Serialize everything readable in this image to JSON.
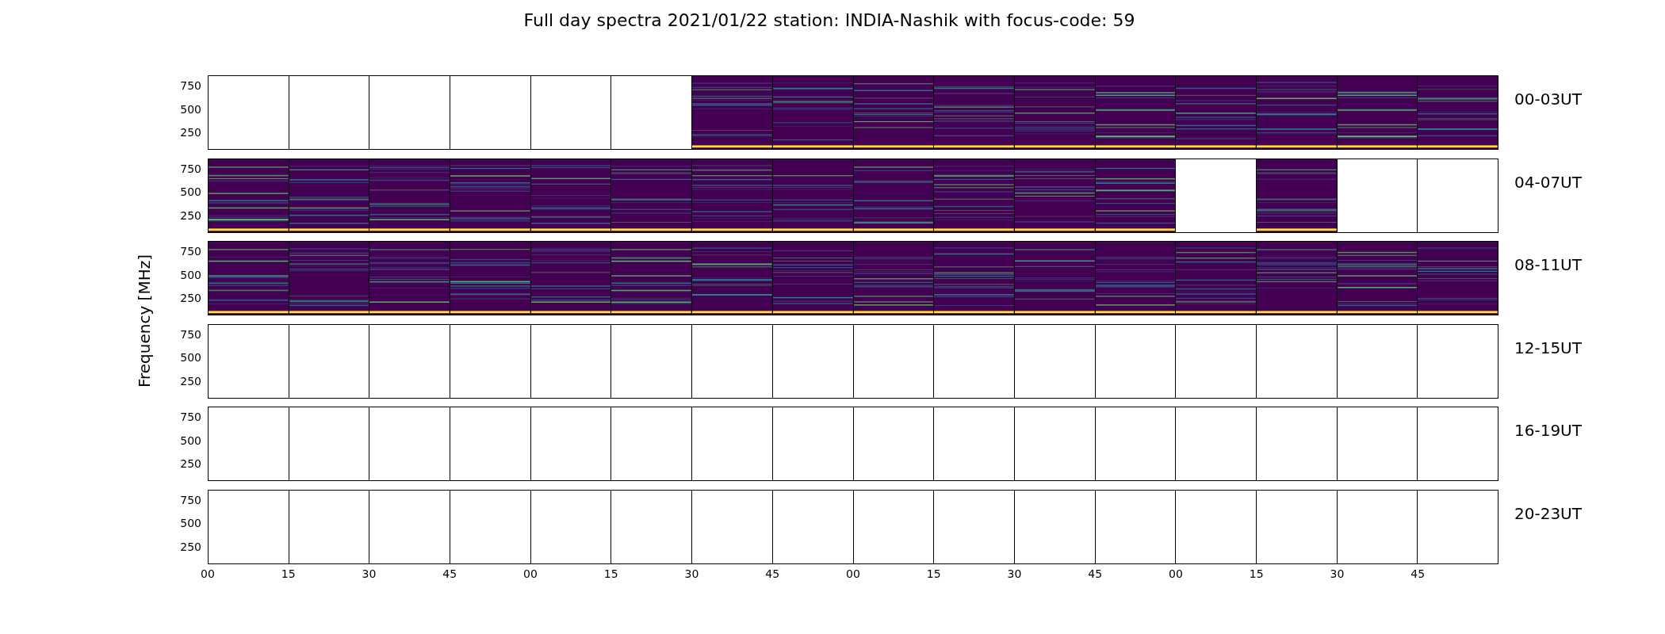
{
  "title": "Full day spectra 2021/01/22 station: INDIA-Nashik with focus-code: 59",
  "ylabel": "Frequency [MHz]",
  "rows": [
    {
      "label": "00-03UT",
      "yticks": [
        "750",
        "500",
        "250"
      ],
      "panels": [
        false,
        false,
        false,
        false,
        false,
        false,
        true,
        true,
        true,
        true,
        true,
        true,
        true,
        true,
        true,
        true
      ]
    },
    {
      "label": "04-07UT",
      "yticks": [
        "750",
        "500",
        "250"
      ],
      "panels": [
        true,
        true,
        true,
        true,
        true,
        true,
        true,
        true,
        true,
        true,
        true,
        true,
        false,
        true,
        false,
        false
      ]
    },
    {
      "label": "08-11UT",
      "yticks": [
        "750",
        "500",
        "250"
      ],
      "panels": [
        true,
        true,
        true,
        true,
        true,
        true,
        true,
        true,
        true,
        true,
        true,
        true,
        true,
        true,
        true,
        true
      ]
    },
    {
      "label": "12-15UT",
      "yticks": [
        "750",
        "500",
        "250"
      ],
      "panels": [
        false,
        false,
        false,
        false,
        false,
        false,
        false,
        false,
        false,
        false,
        false,
        false,
        false,
        false,
        false,
        false
      ]
    },
    {
      "label": "16-19UT",
      "yticks": [
        "750",
        "500",
        "250"
      ],
      "panels": [
        false,
        false,
        false,
        false,
        false,
        false,
        false,
        false,
        false,
        false,
        false,
        false,
        false,
        false,
        false,
        false
      ]
    },
    {
      "label": "20-23UT",
      "yticks": [
        "750",
        "500",
        "250"
      ],
      "panels": [
        false,
        false,
        false,
        false,
        false,
        false,
        false,
        false,
        false,
        false,
        false,
        false,
        false,
        false,
        false,
        false
      ]
    }
  ],
  "xticks": [
    "00",
    "15",
    "30",
    "45",
    "00",
    "15",
    "30",
    "45",
    "00",
    "15",
    "30",
    "45",
    "00",
    "15",
    "30",
    "45"
  ]
}
